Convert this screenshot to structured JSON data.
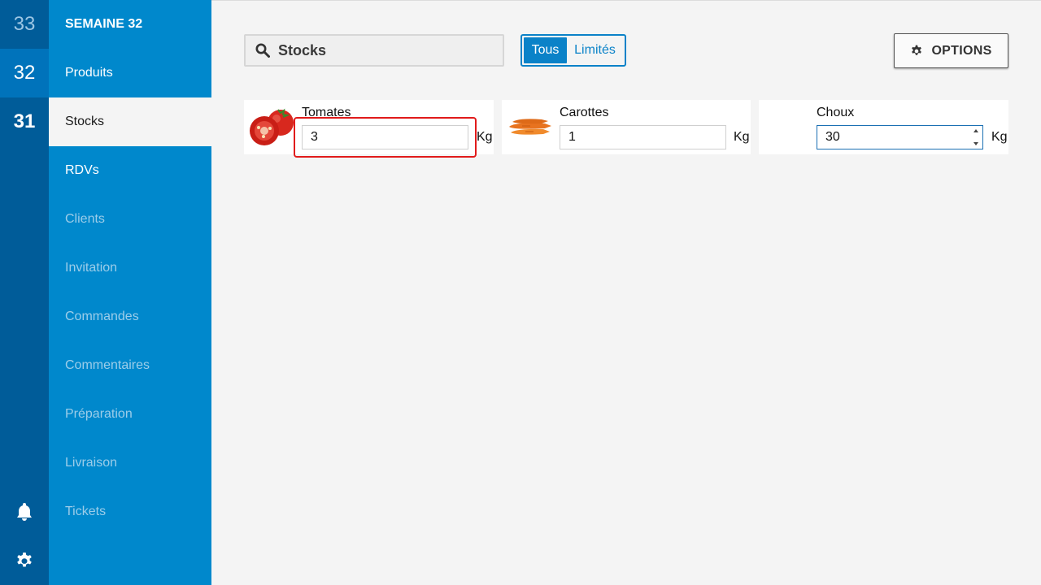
{
  "weeks": [
    {
      "label": "33"
    },
    {
      "label": "32"
    },
    {
      "label": "31"
    }
  ],
  "nav": {
    "header": "SEMAINE 32",
    "items": [
      {
        "label": "Produits"
      },
      {
        "label": "Stocks"
      },
      {
        "label": "RDVs"
      },
      {
        "label": "Clients"
      },
      {
        "label": "Invitation"
      },
      {
        "label": "Commandes"
      },
      {
        "label": "Commentaires"
      },
      {
        "label": "Préparation"
      },
      {
        "label": "Livraison"
      },
      {
        "label": "Tickets"
      }
    ]
  },
  "search": {
    "label": "Stocks",
    "icon": "search-icon"
  },
  "filter": {
    "all": "Tous",
    "limited": "Limités"
  },
  "options": {
    "label": "OPTIONS",
    "icon": "gear-icon"
  },
  "products": [
    {
      "name": "Tomates",
      "qty": "3",
      "unit": "Kg"
    },
    {
      "name": "Carottes",
      "qty": "1",
      "unit": "Kg"
    },
    {
      "name": "Choux",
      "qty": "30",
      "unit": "Kg"
    }
  ],
  "colors": {
    "rail": "#005c99",
    "nav": "#0088cc",
    "accent": "#0a82c8",
    "highlight": "#e11b1b"
  }
}
